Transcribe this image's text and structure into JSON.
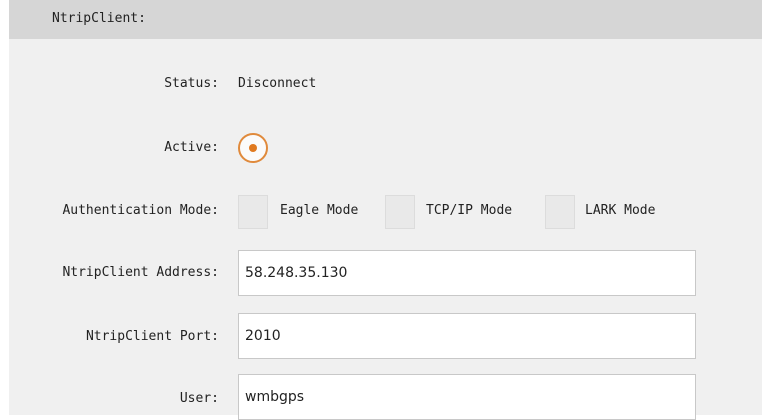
{
  "header": {
    "title": "NtripClient:"
  },
  "status": {
    "label": "Status:",
    "value": "Disconnect"
  },
  "active": {
    "label": "Active:",
    "checked": true,
    "accent": "#e07a20"
  },
  "authentication": {
    "label": "Authentication Mode:",
    "options": [
      {
        "label": "Eagle Mode",
        "checked": false
      },
      {
        "label": "TCP/IP Mode",
        "checked": false
      },
      {
        "label": "LARK Mode",
        "checked": false
      }
    ]
  },
  "address": {
    "label": "NtripClient Address:",
    "value": "58.248.35.130"
  },
  "port": {
    "label": "NtripClient Port:",
    "value": "2010"
  },
  "user": {
    "label": "User:",
    "value": "wmbgps"
  },
  "colors": {
    "panel_background": "#f0f0f0",
    "header_background": "#d6d6d6",
    "input_border": "#c8c8c8"
  }
}
